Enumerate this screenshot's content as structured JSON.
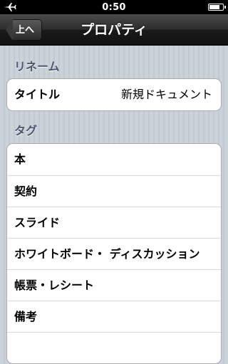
{
  "status_bar": {
    "time": "0:50",
    "battery_level": 0.8
  },
  "nav_bar": {
    "title": "プロパティ",
    "back_label": "上へ"
  },
  "rename_section": {
    "header": "リネーム",
    "rows": [
      {
        "label": "タイトル",
        "value": "新規ドキュメント"
      }
    ]
  },
  "tag_section": {
    "header": "タグ",
    "items": [
      "本",
      "契約",
      "スライド",
      "ホワイトボード・ ディスカッション",
      "帳票・レシート",
      "備考"
    ]
  },
  "icons": {
    "airplane": "airplane-icon",
    "battery": "battery-icon",
    "back": "back-chevron-icon"
  },
  "colors": {
    "nav_bar": "#1f1f1f",
    "section_header": "#4c566c",
    "background": "#c5ccd4"
  }
}
